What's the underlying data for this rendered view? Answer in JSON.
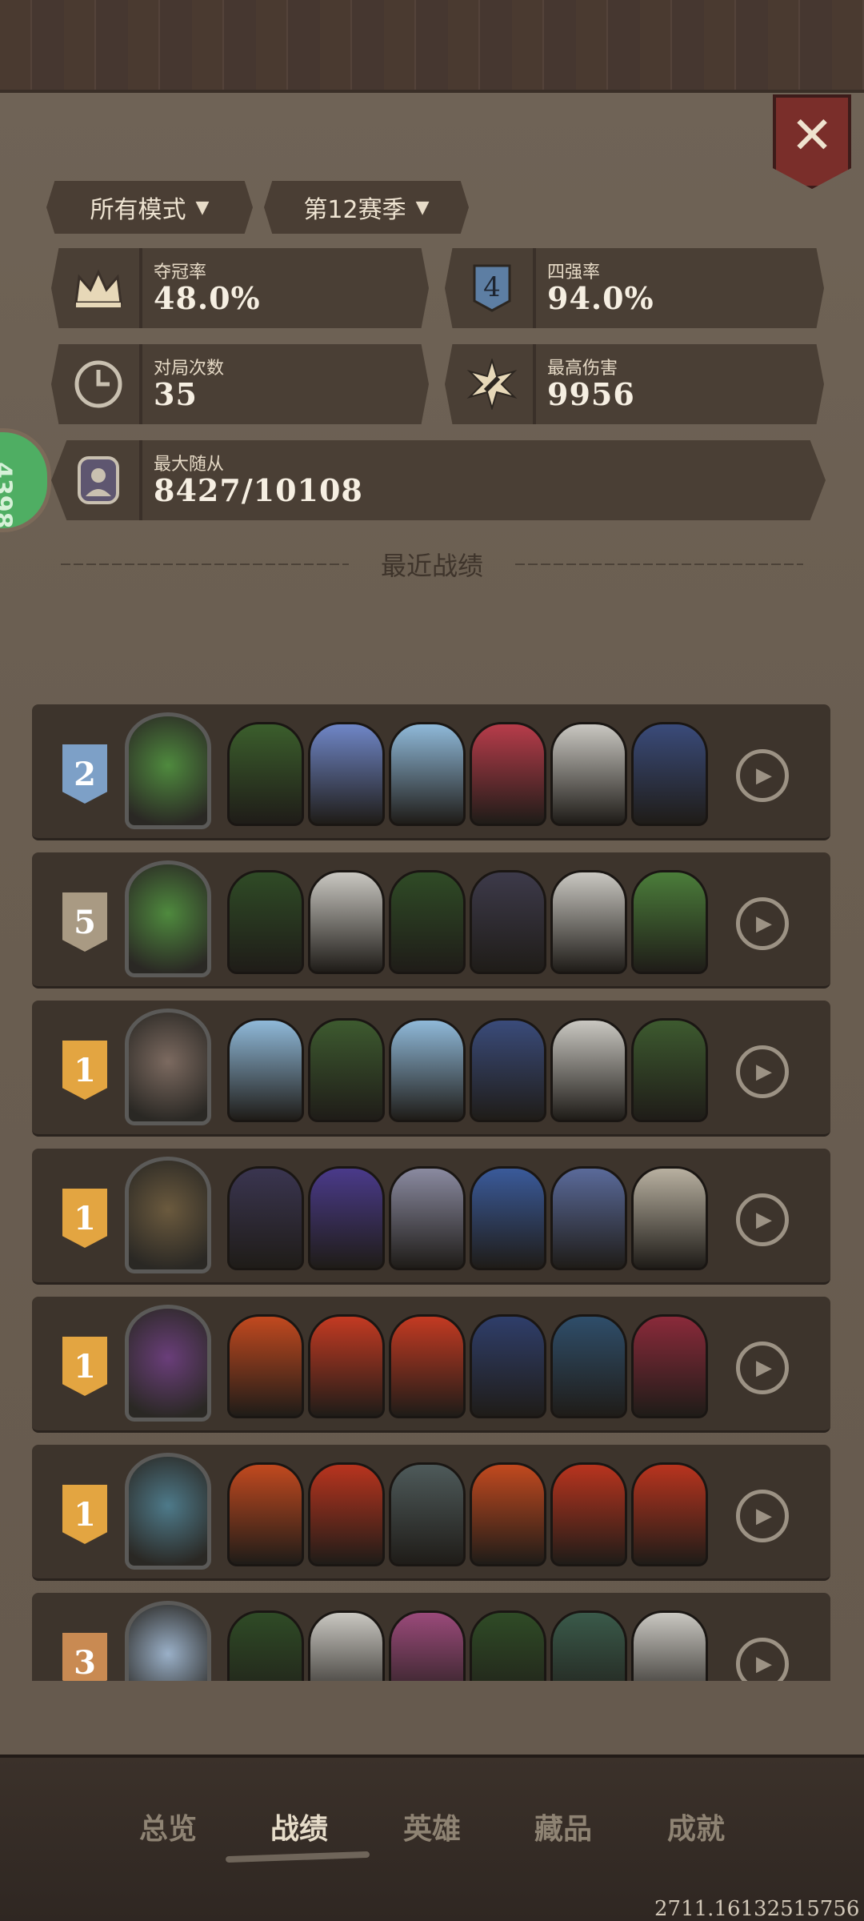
{
  "filters": {
    "mode": "所有模式",
    "season": "第12赛季"
  },
  "close_label": "✕",
  "side_badge": "4398",
  "stats": [
    {
      "label": "夺冠率",
      "value": "48.0%",
      "icon": "crown-icon"
    },
    {
      "label": "四强率",
      "value": "94.0%",
      "icon": "shield-four-icon"
    },
    {
      "label": "对局次数",
      "value": "35",
      "icon": "clock-icon"
    },
    {
      "label": "最高伤害",
      "value": "9956",
      "icon": "burst-icon"
    },
    {
      "label": "最大随从",
      "value": "8427/10108",
      "icon": "portrait-icon"
    }
  ],
  "section_title": "最近战绩",
  "matches": [
    {
      "rank": "2",
      "rank_color": "#7da0c7",
      "hero_color": "#4f8a3e",
      "minions": [
        "#3b5e2c",
        "#6f86c7",
        "#8fb9d9",
        "#b73c4a",
        "#c9c7c1",
        "#3a4b7a"
      ]
    },
    {
      "rank": "5",
      "rank_color": "#a99a83",
      "hero_color": "#4f8a3e",
      "minions": [
        "#2f4b26",
        "#c9c7c1",
        "#2f4b26",
        "#3d3a4a",
        "#c9c7c1",
        "#4b7d3a"
      ]
    },
    {
      "rank": "1",
      "rank_color": "#e3a541",
      "hero_color": "#7c6a60",
      "minions": [
        "#8fb9d9",
        "#3d5a2f",
        "#8fb9d9",
        "#3a4b7a",
        "#c9c7c1",
        "#3d5a2f"
      ]
    },
    {
      "rank": "1",
      "rank_color": "#e3a541",
      "hero_color": "#6b5a3e",
      "minions": [
        "#3a3550",
        "#4a3a8a",
        "#8a8aa0",
        "#3a5a9a",
        "#5a6a9a",
        "#b8b0a0"
      ]
    },
    {
      "rank": "1",
      "rank_color": "#e3a541",
      "hero_color": "#6a3e7a",
      "minions": [
        "#c1491f",
        "#c33a22",
        "#c33a22",
        "#2f3e6a",
        "#2f4e6a",
        "#8a2a3a"
      ]
    },
    {
      "rank": "1",
      "rank_color": "#e3a541",
      "hero_color": "#4e7a8a",
      "minions": [
        "#c1491f",
        "#b8341e",
        "#4e5a5a",
        "#c1491f",
        "#b8341e",
        "#b8341e"
      ]
    },
    {
      "rank": "3",
      "rank_color": "#c98a52",
      "hero_color": "#9ab0c8",
      "minions": [
        "#2f4b26",
        "#c9c7c1",
        "#9a4a7a",
        "#2f4b26",
        "#3a5a4a",
        "#c9c7c1"
      ]
    }
  ],
  "tabs": [
    "总览",
    "战绩",
    "英雄",
    "藏品",
    "成就"
  ],
  "active_tab": "战绩",
  "footer_id": "2711.16132515756"
}
